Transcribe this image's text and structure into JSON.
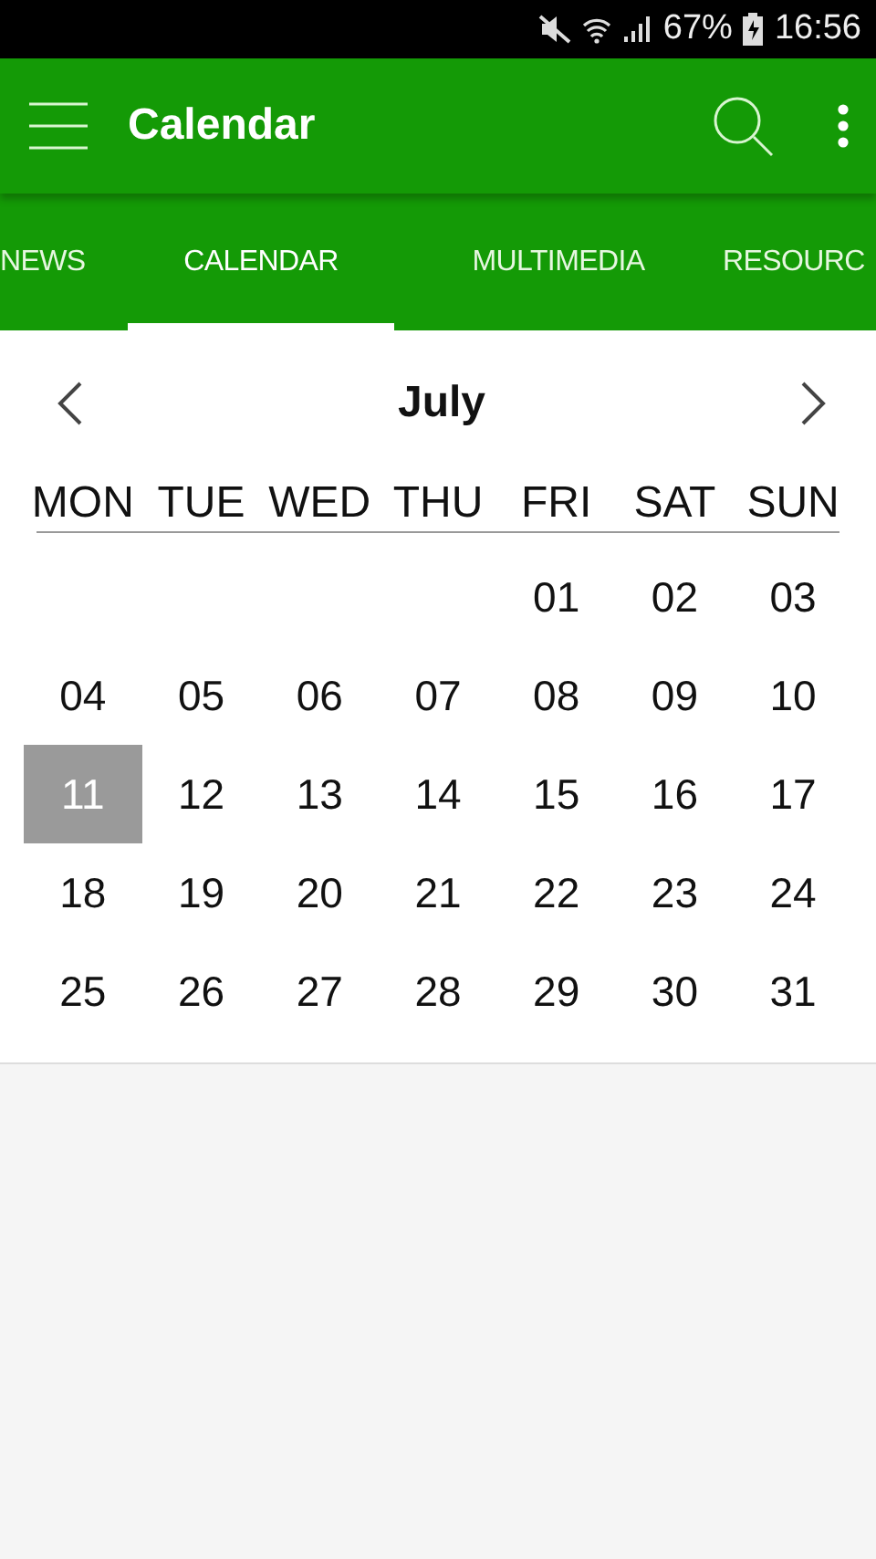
{
  "status_bar": {
    "battery": "67%",
    "time": "16:56"
  },
  "app_bar": {
    "title": "Calendar"
  },
  "tabs": [
    {
      "label": "NEWS",
      "selected": false
    },
    {
      "label": "CALENDAR",
      "selected": true
    },
    {
      "label": "MULTIMEDIA",
      "selected": false
    },
    {
      "label": "RESOURC",
      "selected": false
    }
  ],
  "calendar": {
    "month": "July",
    "weekdays": [
      "MON",
      "TUE",
      "WED",
      "THU",
      "FRI",
      "SAT",
      "SUN"
    ],
    "weeks": [
      [
        {
          "day": "01",
          "selected": false
        },
        {
          "day": "02",
          "selected": false
        },
        {
          "day": "03",
          "selected": false
        }
      ],
      [
        {
          "day": "04",
          "selected": false
        },
        {
          "day": "05",
          "selected": false
        },
        {
          "day": "06",
          "selected": false
        },
        {
          "day": "07",
          "selected": false
        },
        {
          "day": "08",
          "selected": false
        },
        {
          "day": "09",
          "selected": false
        },
        {
          "day": "10",
          "selected": false
        }
      ],
      [
        {
          "day": "11",
          "selected": true
        },
        {
          "day": "12",
          "selected": false
        },
        {
          "day": "13",
          "selected": false
        },
        {
          "day": "14",
          "selected": false
        },
        {
          "day": "15",
          "selected": false
        },
        {
          "day": "16",
          "selected": false
        },
        {
          "day": "17",
          "selected": false
        }
      ],
      [
        {
          "day": "18",
          "selected": false
        },
        {
          "day": "19",
          "selected": false
        },
        {
          "day": "20",
          "selected": false
        },
        {
          "day": "21",
          "selected": false
        },
        {
          "day": "22",
          "selected": false
        },
        {
          "day": "23",
          "selected": false
        },
        {
          "day": "24",
          "selected": false
        }
      ],
      [
        {
          "day": "25",
          "selected": false
        },
        {
          "day": "26",
          "selected": false
        },
        {
          "day": "27",
          "selected": false
        },
        {
          "day": "28",
          "selected": false
        },
        {
          "day": "29",
          "selected": false
        },
        {
          "day": "30",
          "selected": false
        },
        {
          "day": "31",
          "selected": false
        }
      ]
    ]
  }
}
